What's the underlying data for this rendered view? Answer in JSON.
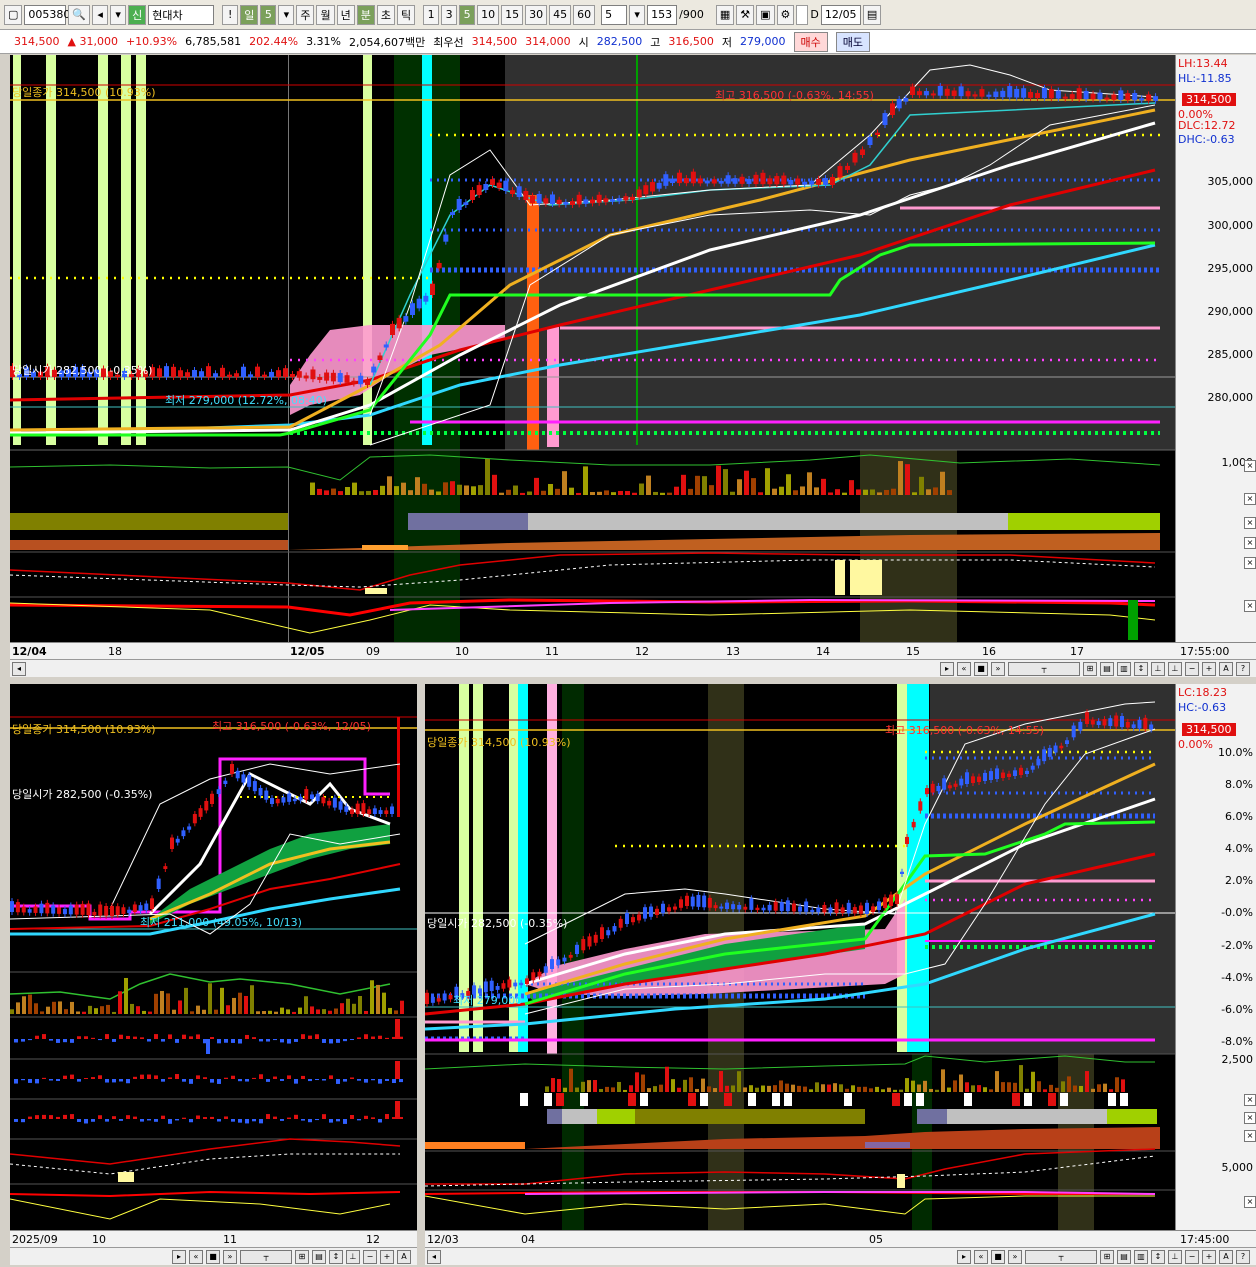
{
  "toolbar": {
    "code": "005380",
    "badge": "신",
    "name": "현대차",
    "alert": "!",
    "periods": [
      "일",
      "5",
      "주",
      "월",
      "년",
      "분",
      "초",
      "틱"
    ],
    "intervals": [
      "1",
      "3",
      "5",
      "10",
      "15",
      "30",
      "45",
      "60"
    ],
    "interval_selected": "5",
    "bar_count": "153",
    "bar_total": "/900",
    "date_check": "D",
    "date_value": "12/05"
  },
  "quote": {
    "price": "314,500",
    "change": "▲  31,000",
    "change_pct": "+10.93%",
    "volume": "6,785,581",
    "volume_ratio": "202.44%",
    "turnover_rate": "3.31%",
    "amount": "2,054,607백만",
    "priority": "최우선",
    "bid": "314,500",
    "ask": "314,000",
    "open_label": "시",
    "open": "282,500",
    "high_label": "고",
    "high": "316,500",
    "low_label": "저",
    "low": "279,000",
    "buy_label": "매수",
    "sell_label": "매도"
  },
  "top_chart": {
    "close_label": "당일종가 314,500 (10.93%)",
    "open_label": "당일시가 282,500 (-0.35%)",
    "high_label": "최고 316,500 (-0.63%, 14:55)",
    "low_label": "최저 279,000 (12.72%, 08:40)",
    "right_labels": [
      "LH:13.44",
      "HL:-11.85",
      "314,500",
      "0.00%",
      "DLC:12.72",
      "DHC:-0.63"
    ],
    "price_ticks": [
      "305,000",
      "300,000",
      "295,000",
      "290,000",
      "285,000",
      "280,000"
    ],
    "volume_tick": "1,000",
    "x_labels": [
      "12/04",
      "18",
      "12/05",
      "09",
      "10",
      "11",
      "12",
      "13",
      "14",
      "15",
      "16",
      "17"
    ],
    "time": "17:55:00"
  },
  "bottom_left_chart": {
    "close_label": "당일종가 314,500 (10.93%)",
    "open_label": "당일시가 282,500 (-0.35%)",
    "high_label": "최고 316,500 (-0.63%, 12/05)",
    "low_label": "최저 211,000 (49.05%, 10/13)",
    "x_labels": [
      "2025/09",
      "10",
      "11",
      "12"
    ]
  },
  "bottom_right_chart": {
    "close_label": "당일종가 314,500 (10.93%)",
    "open_label": "당일시가 282,500 (-0.35%)",
    "high_label": "최고 316,500 (-0.63%, 14:55)",
    "low_label": "최저 279,000",
    "right_labels": [
      "LC:18.23",
      "HC:-0.63",
      "314,500",
      "0.00%"
    ],
    "pct_ticks": [
      "10.0%",
      "8.0%",
      "6.0%",
      "4.0%",
      "2.0%",
      "-0.0%",
      "-2.0%",
      "-4.0%",
      "-6.0%",
      "-8.0%"
    ],
    "volume_tick": "2,500",
    "osc_tick": "5,000",
    "x_labels": [
      "12/03",
      "04",
      "05"
    ],
    "time": "17:45:00"
  },
  "colors": {
    "up": "#e01010",
    "down": "#3060ff",
    "background": "#000000",
    "highlight_green": "#d8ffa0",
    "highlight_cyan": "#00ffff",
    "pink_cloud": "#ff9ad0"
  }
}
